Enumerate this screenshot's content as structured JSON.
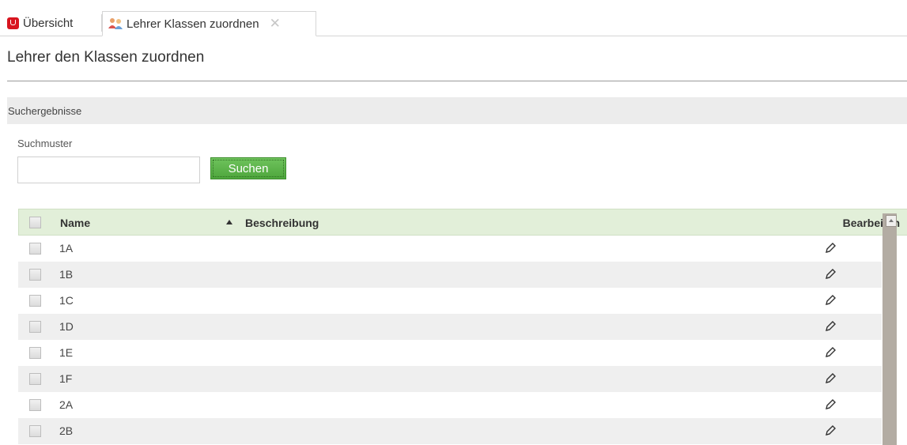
{
  "tabs": [
    {
      "label": "Übersicht",
      "icon": "app-logo-icon"
    },
    {
      "label": "Lehrer Klassen zuordnen",
      "icon": "people-icon",
      "closable": true
    }
  ],
  "page_title": "Lehrer den Klassen zuordnen",
  "section_title": "Suchergebnisse",
  "search": {
    "label": "Suchmuster",
    "value": "",
    "button_label": "Suchen"
  },
  "table": {
    "columns": {
      "name": "Name",
      "description": "Beschreibung",
      "edit": "Bearbeiten"
    },
    "sort_column": "Name",
    "sort_direction": "ascending",
    "rows": [
      {
        "name": "1A",
        "description": ""
      },
      {
        "name": "1B",
        "description": ""
      },
      {
        "name": "1C",
        "description": ""
      },
      {
        "name": "1D",
        "description": ""
      },
      {
        "name": "1E",
        "description": ""
      },
      {
        "name": "1F",
        "description": ""
      },
      {
        "name": "2A",
        "description": ""
      },
      {
        "name": "2B",
        "description": ""
      }
    ]
  },
  "colors": {
    "accent_green": "#5bb348",
    "table_header_bg": "#e2efd9",
    "app_red": "#d8151f"
  }
}
